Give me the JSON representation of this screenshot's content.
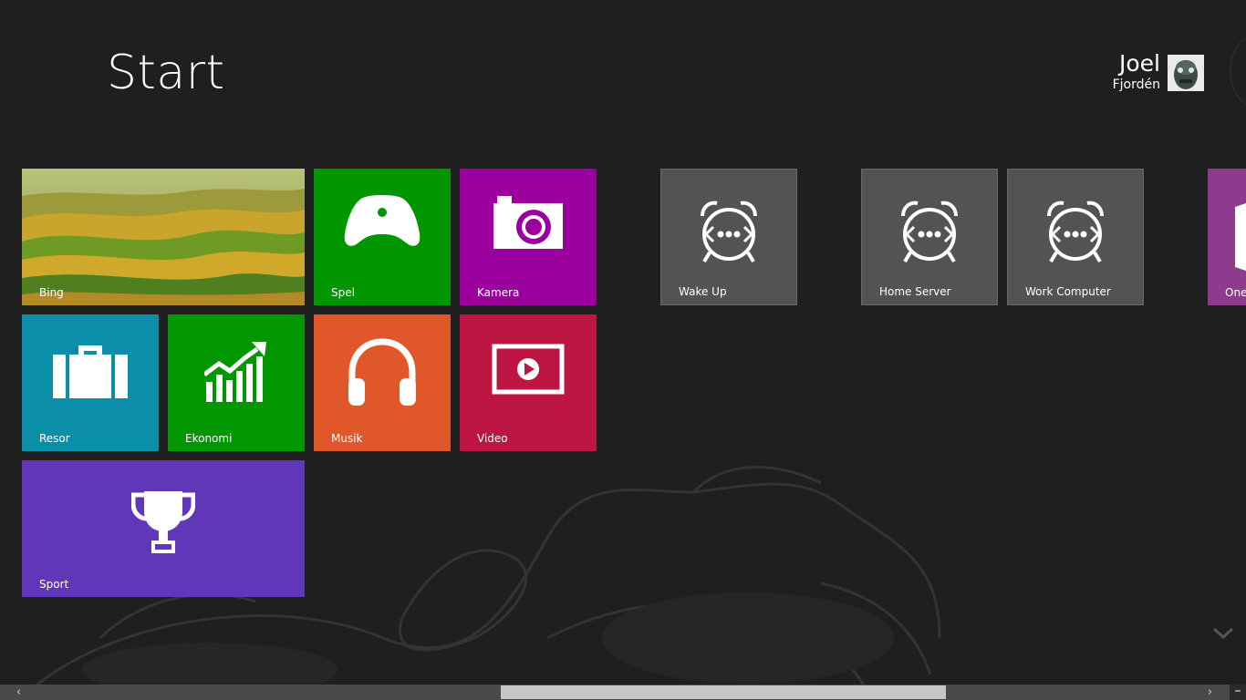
{
  "header": {
    "title": "Start"
  },
  "user": {
    "first_name": "Joel",
    "last_name": "Fjordén"
  },
  "colors": {
    "background": "#1f1f1f",
    "bing": "#6b8a2c",
    "spel": "#019600",
    "kamera": "#9b009e",
    "resor": "#0b8fa8",
    "ekonomi": "#029700",
    "musik": "#e0582a",
    "video": "#bd1642",
    "sport": "#5f37b8",
    "alarm": "#535353",
    "onenote": "#8e3a8d"
  },
  "tiles": {
    "bing": {
      "label": "Bing",
      "icon": "landscape-photo"
    },
    "spel": {
      "label": "Spel",
      "icon": "game-controller-icon"
    },
    "kamera": {
      "label": "Kamera",
      "icon": "camera-icon"
    },
    "resor": {
      "label": "Resor",
      "icon": "suitcase-icon"
    },
    "ekonomi": {
      "label": "Ekonomi",
      "icon": "chart-up-icon"
    },
    "musik": {
      "label": "Musik",
      "icon": "headphones-icon"
    },
    "video": {
      "label": "Video",
      "icon": "video-play-icon"
    },
    "sport": {
      "label": "Sport",
      "icon": "trophy-icon"
    },
    "wake_up": {
      "label": "Wake Up",
      "icon": "alarm-clock-icon"
    },
    "home_server": {
      "label": "Home Server",
      "icon": "alarm-clock-icon"
    },
    "work_computer": {
      "label": "Work Computer",
      "icon": "alarm-clock-icon"
    },
    "onenote": {
      "label": "One",
      "icon": "onenote-icon"
    }
  },
  "scrollbar": {
    "left_arrow": "‹",
    "right_arrow": "›",
    "position": 0.4
  },
  "minimize": {
    "label": "–"
  }
}
